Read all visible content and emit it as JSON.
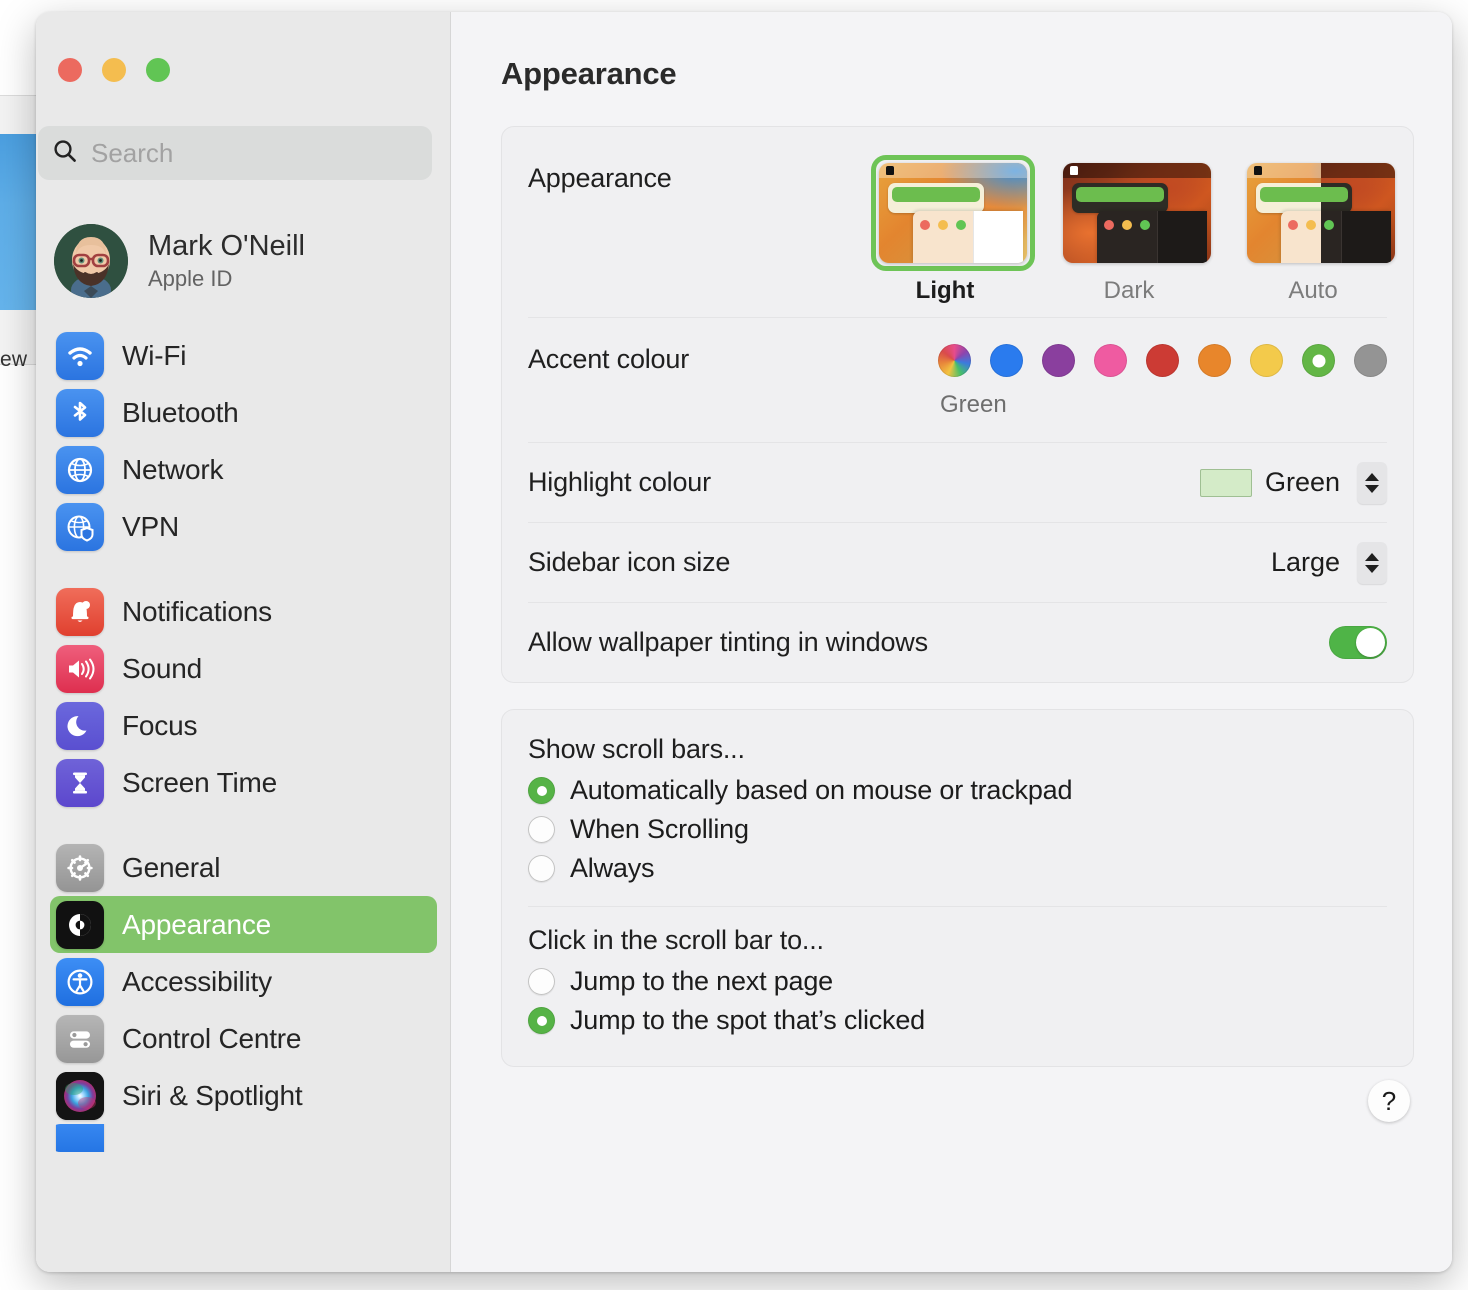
{
  "background_window": {
    "text": "ew"
  },
  "sidebar": {
    "search": {
      "placeholder": "Search",
      "value": "",
      "icon": "search-icon"
    },
    "profile": {
      "name": "Mark O'Neill",
      "subtitle": "Apple ID"
    },
    "groups": [
      {
        "items": [
          {
            "label": "Wi-Fi",
            "icon": "wifi-icon"
          },
          {
            "label": "Bluetooth",
            "icon": "bluetooth-icon"
          },
          {
            "label": "Network",
            "icon": "globe-icon"
          },
          {
            "label": "VPN",
            "icon": "globe-shield-icon"
          }
        ]
      },
      {
        "items": [
          {
            "label": "Notifications",
            "icon": "bell-icon"
          },
          {
            "label": "Sound",
            "icon": "speaker-icon"
          },
          {
            "label": "Focus",
            "icon": "moon-icon"
          },
          {
            "label": "Screen Time",
            "icon": "hourglass-icon"
          }
        ]
      },
      {
        "items": [
          {
            "label": "General",
            "icon": "gear-icon"
          },
          {
            "label": "Appearance",
            "icon": "appearance-icon",
            "selected": true
          },
          {
            "label": "Accessibility",
            "icon": "accessibility-icon"
          },
          {
            "label": "Control Centre",
            "icon": "control-centre-icon"
          },
          {
            "label": "Siri & Spotlight",
            "icon": "siri-icon"
          }
        ]
      }
    ]
  },
  "content": {
    "title": "Appearance",
    "appearance": {
      "label": "Appearance",
      "options": [
        {
          "name": "Light",
          "selected": true
        },
        {
          "name": "Dark",
          "selected": false
        },
        {
          "name": "Auto",
          "selected": false
        }
      ]
    },
    "accent": {
      "label": "Accent colour",
      "selected_name": "Green",
      "swatches": [
        {
          "name": "Multicolour",
          "color": "multi",
          "selected": false
        },
        {
          "name": "Blue",
          "color": "#2a7bee",
          "selected": false
        },
        {
          "name": "Purple",
          "color": "#8a3f9e",
          "selected": false
        },
        {
          "name": "Pink",
          "color": "#ef5ba1",
          "selected": false
        },
        {
          "name": "Red",
          "color": "#cc3b34",
          "selected": false
        },
        {
          "name": "Orange",
          "color": "#e8862b",
          "selected": false
        },
        {
          "name": "Yellow",
          "color": "#f3ca4b",
          "selected": false
        },
        {
          "name": "Green",
          "color": "#63b646",
          "selected": true
        },
        {
          "name": "Graphite",
          "color": "#949494",
          "selected": false
        }
      ]
    },
    "highlight": {
      "label": "Highlight colour",
      "value": "Green",
      "swatch_color": "#d4ebc8"
    },
    "sidebar_icon_size": {
      "label": "Sidebar icon size",
      "value": "Large"
    },
    "wallpaper_tinting": {
      "label": "Allow wallpaper tinting in windows",
      "enabled": true
    },
    "show_scroll_bars": {
      "heading": "Show scroll bars...",
      "options": [
        {
          "label": "Automatically based on mouse or trackpad",
          "selected": true
        },
        {
          "label": "When Scrolling",
          "selected": false
        },
        {
          "label": "Always",
          "selected": false
        }
      ]
    },
    "click_scroll_bar": {
      "heading": "Click in the scroll bar to...",
      "options": [
        {
          "label": "Jump to the next page",
          "selected": false
        },
        {
          "label": "Jump to the spot that’s clicked",
          "selected": true
        }
      ]
    },
    "help_button": "?"
  }
}
